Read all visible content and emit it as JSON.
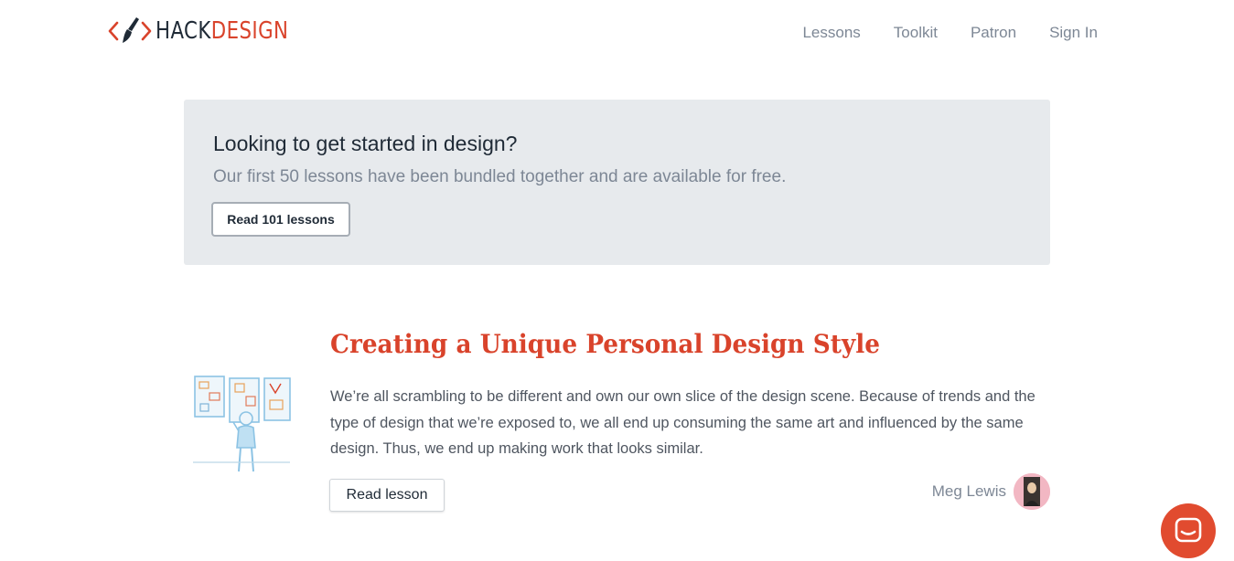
{
  "brand": {
    "hack": "HACK",
    "design": "DESIGN",
    "accent_color": "#d9432b",
    "dark_color": "#1f2a36"
  },
  "nav": {
    "items": [
      {
        "label": "Lessons"
      },
      {
        "label": "Toolkit"
      },
      {
        "label": "Patron"
      },
      {
        "label": "Sign In"
      }
    ]
  },
  "banner": {
    "title": "Looking to get started in design?",
    "subtitle": "Our first 50 lessons have been bundled together and are available for free.",
    "button_label": "Read 101 lessons",
    "background": "#e7eaed"
  },
  "lesson": {
    "title": "Creating a Unique Personal Design Style",
    "description": "We’re all scrambling to be different and own our own slice of the design scene. Because of trends and the type of design that we’re exposed to, we all end up consuming the same art and influenced by the same design. Thus, we end up making work that looks similar.",
    "button_label": "Read lesson",
    "author": "Meg Lewis",
    "illustration_icon": "gallery-viewer-illustration"
  },
  "chat": {
    "icon": "chat-bubble-icon",
    "color": "#e14b2f"
  }
}
